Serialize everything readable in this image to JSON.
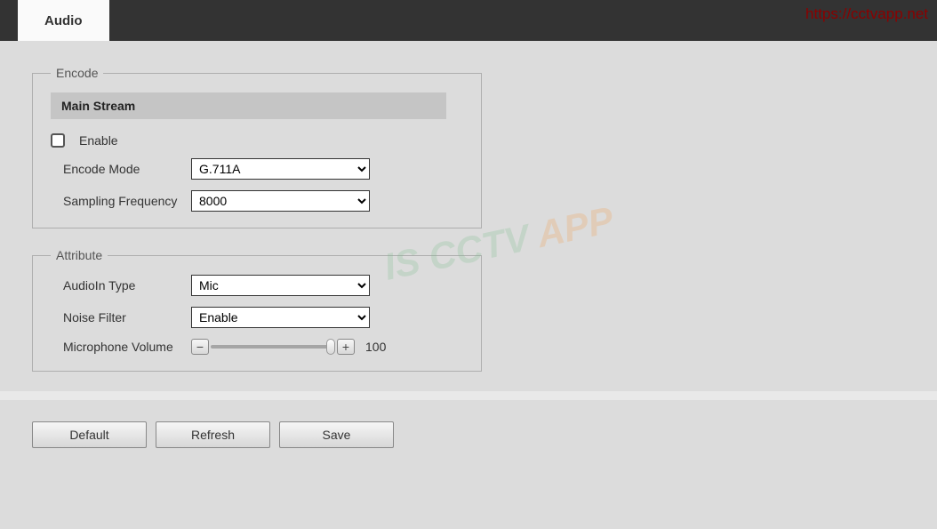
{
  "watermark_url": "https://cctvapp.net",
  "tabs": {
    "audio": "Audio"
  },
  "encode": {
    "legend": "Encode",
    "stream_header": "Main Stream",
    "enable_label": "Enable",
    "enable_checked": false,
    "mode_label": "Encode Mode",
    "mode_value": "G.711A",
    "sampling_label": "Sampling Frequency",
    "sampling_value": "8000"
  },
  "attribute": {
    "legend": "Attribute",
    "audioin_label": "AudioIn Type",
    "audioin_value": "Mic",
    "noise_label": "Noise Filter",
    "noise_value": "Enable",
    "mic_label": "Microphone Volume",
    "mic_value": "100"
  },
  "buttons": {
    "default": "Default",
    "refresh": "Refresh",
    "save": "Save"
  },
  "wm2": {
    "a": "IS CCTV ",
    "b": "APP"
  }
}
